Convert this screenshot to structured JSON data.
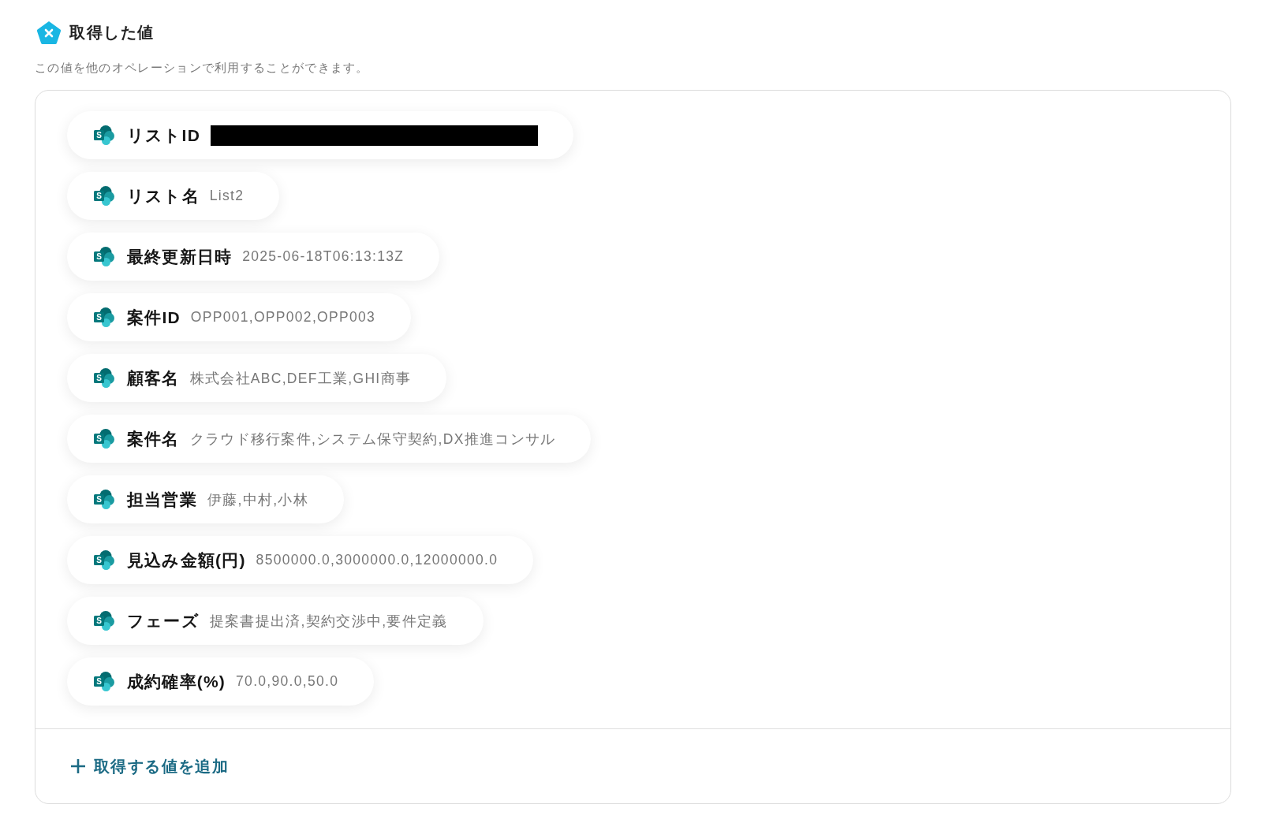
{
  "header": {
    "title": "取得した値",
    "description": "この値を他のオペレーションで利用することができます。"
  },
  "values": [
    {
      "icon_letter": "S",
      "label": "リストID",
      "redacted": true
    },
    {
      "icon_letter": "S",
      "label": "リスト名",
      "value": "List2",
      "redacted": false
    },
    {
      "icon_letter": "S",
      "label": "最終更新日時",
      "value": "2025-06-18T06:13:13Z",
      "redacted": false
    },
    {
      "icon_letter": "S",
      "label": "案件ID",
      "value": "OPP001,OPP002,OPP003",
      "redacted": false
    },
    {
      "icon_letter": "S",
      "label": "顧客名",
      "value": "株式会社ABC,DEF工業,GHI商事",
      "redacted": false
    },
    {
      "icon_letter": "S",
      "label": "案件名",
      "value": "クラウド移行案件,システム保守契約,DX推進コンサル",
      "redacted": false
    },
    {
      "icon_letter": "S",
      "label": "担当営業",
      "value": "伊藤,中村,小林",
      "redacted": false
    },
    {
      "icon_letter": "S",
      "label": "見込み金額(円)",
      "value": "8500000.0,3000000.0,12000000.0",
      "redacted": false
    },
    {
      "icon_letter": "S",
      "label": "フェーズ",
      "value": "提案書提出済,契約交渉中,要件定義",
      "redacted": false
    },
    {
      "icon_letter": "S",
      "label": "成約確率(%)",
      "value": "70.0,90.0,50.0",
      "redacted": false
    }
  ],
  "add_button": {
    "label": "取得する値を追加"
  }
}
